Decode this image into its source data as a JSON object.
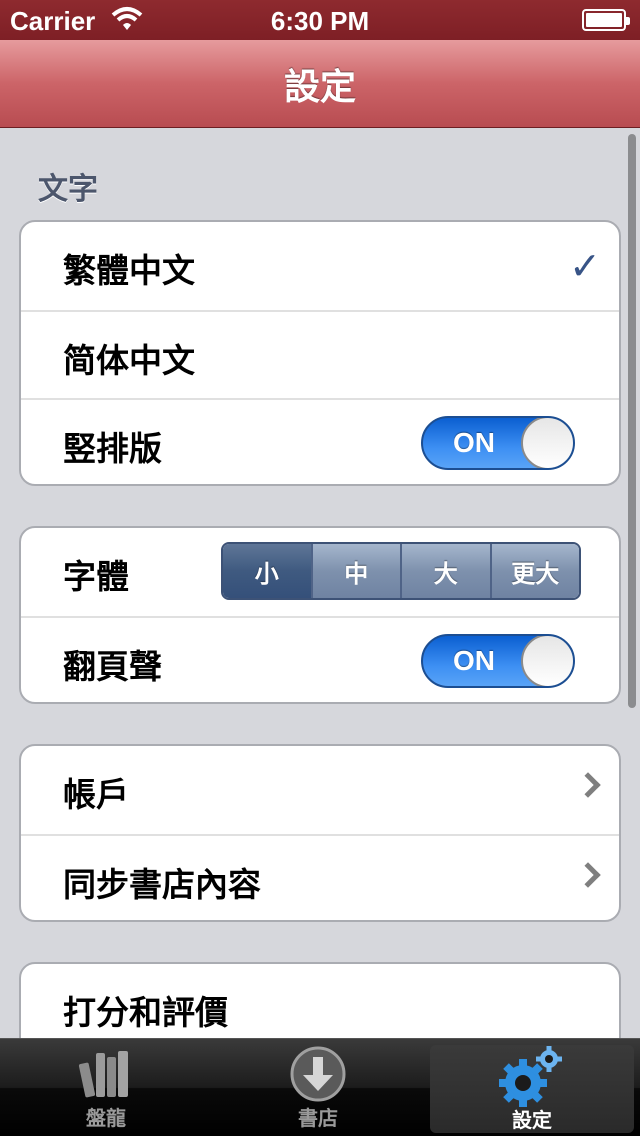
{
  "status_bar": {
    "carrier": "Carrier",
    "time": "6:30 PM"
  },
  "nav": {
    "title": "設定"
  },
  "sections": {
    "text_header": "文字",
    "group1": {
      "row1_label": "繁體中文",
      "row2_label": "简体中文",
      "row3_label": "竪排版",
      "row3_toggle": "ON"
    },
    "group2": {
      "font_label": "字體",
      "font_options": [
        "小",
        "中",
        "大",
        "更大"
      ],
      "font_selected": "小",
      "sound_label": "翻頁聲",
      "sound_toggle": "ON"
    },
    "group3": {
      "account_label": "帳戶",
      "sync_label": "同步書店內容"
    },
    "group4": {
      "rate_label": "打分和評價"
    }
  },
  "tab_bar": {
    "tabs": [
      {
        "label": "盤龍",
        "icon": "books-icon"
      },
      {
        "label": "書店",
        "icon": "download-icon"
      },
      {
        "label": "設定",
        "icon": "gear-icon"
      }
    ],
    "active": "設定"
  },
  "colors": {
    "nav_bar": "#cc6468",
    "toggle_on": "#3d8ff3",
    "segment_selected": "#3f5a80",
    "checkmark": "#385487"
  }
}
